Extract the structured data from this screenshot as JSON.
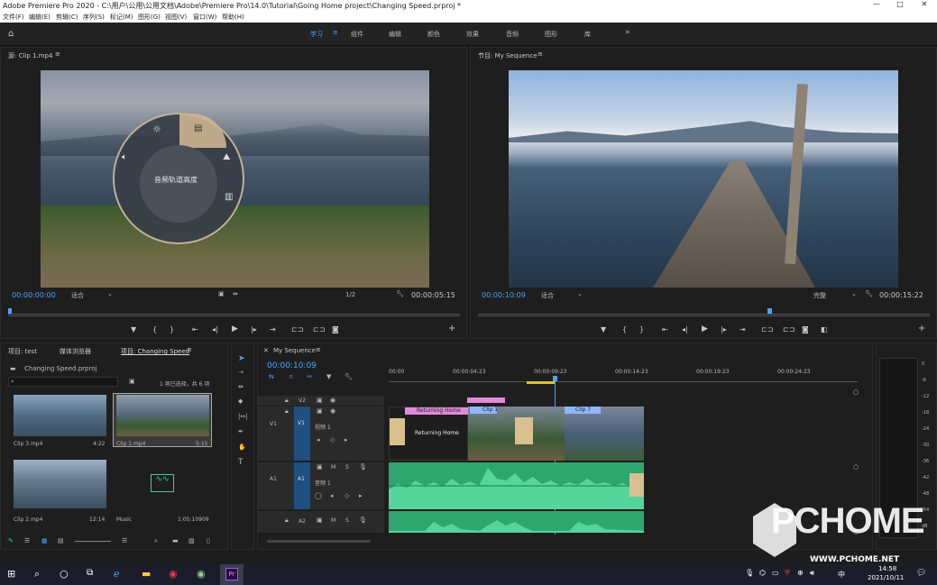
{
  "window": {
    "title": "Adobe Premiere Pro 2020 - C:\\用户\\公用\\公用文档\\Adobe\\Premiere Pro\\14.0\\Tutorial\\Going Home project\\Changing Speed.prproj *"
  },
  "menu": [
    "文件(F)",
    "编辑(E)",
    "剪辑(C)",
    "序列(S)",
    "标记(M)",
    "图形(G)",
    "视图(V)",
    "窗口(W)",
    "帮助(H)"
  ],
  "workspaces": [
    "学习",
    "组件",
    "编辑",
    "颜色",
    "效果",
    "音频",
    "图形",
    "库"
  ],
  "source": {
    "tab": "源: Clip 1.mp4",
    "timecode": "00:00:00:00",
    "fit": "适合",
    "res": "1/2",
    "duration": "00:00:05:15",
    "wheel_label": "音频轨道高度"
  },
  "program": {
    "tab": "节目: My Sequence",
    "timecode": "00:00:10:09",
    "fit": "适合",
    "res": "完整",
    "duration": "00:00:15:22"
  },
  "project": {
    "tabs": [
      "项目: test",
      "媒体浏览器",
      "项目: Changing Speed"
    ],
    "file": "Changing Speed.prproj",
    "selection": "1 项已选择，共 6 项",
    "items": [
      {
        "name": "Clip 3.mp4",
        "dur": "4:22"
      },
      {
        "name": "Clip 1.mp4",
        "dur": "5:15"
      },
      {
        "name": "Clip 2.mp4",
        "dur": "12:14"
      },
      {
        "name": "Music",
        "dur": "1:05:10909"
      }
    ]
  },
  "timeline": {
    "tab": "My Sequence",
    "timecode": "00:00:10:09",
    "ruler": [
      "00:00",
      "00:00:04:23",
      "00:00:09:23",
      "00:00:14:23",
      "00:00:19:23",
      "00:00:24:23"
    ],
    "tracks": {
      "v2": "V2",
      "v1": "V1",
      "a1": "A1",
      "a2": "A2",
      "v1name": "视频 1",
      "a1name": "音频 1"
    },
    "clips": {
      "title": "Returning Home",
      "clip1": "Clip 1",
      "clip": "Clip",
      "clip7": "Clip 7",
      "title_text": "Returning Home"
    }
  },
  "meter": [
    "0",
    "-6",
    "-12",
    "-18",
    "-24",
    "-30",
    "-36",
    "-42",
    "-48",
    "-54",
    "dB"
  ],
  "watermark": {
    "logo": "PCHOME",
    "url": "WWW.PCHOME.NET"
  },
  "taskbar": {
    "time": "14:58",
    "date": "2021/10/11",
    "lang": "中"
  }
}
